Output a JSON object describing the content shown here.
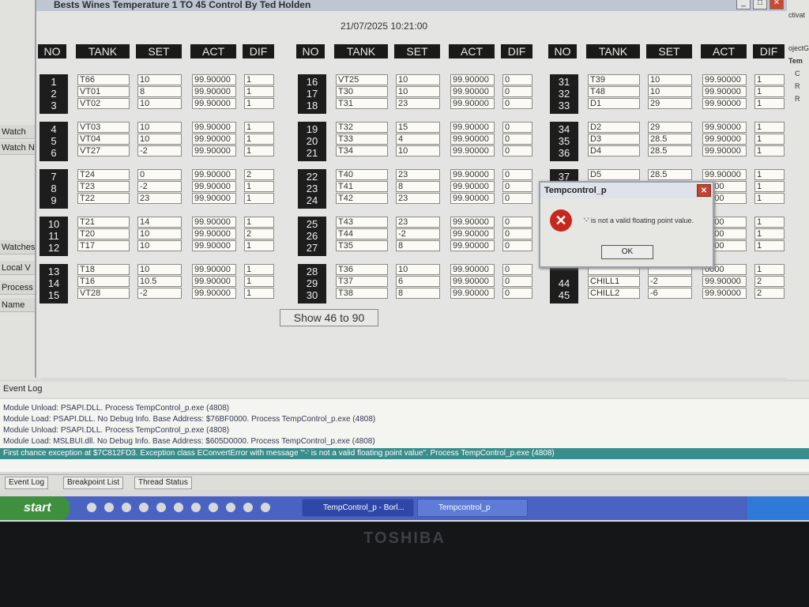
{
  "window": {
    "title": "Bests Wines Temperature 1  TO 45 Control By Ted Holden",
    "datetime": "21/07/2025 10:21:00"
  },
  "headers": [
    "NO",
    "TANK",
    "SET",
    "ACT",
    "DIF"
  ],
  "columns": [
    {
      "groups": [
        [
          {
            "no": "1",
            "tank": "T66",
            "set": "10",
            "act": "99.90000",
            "dif": "1"
          },
          {
            "no": "2",
            "tank": "VT01",
            "set": "8",
            "act": "99.90000",
            "dif": "1"
          },
          {
            "no": "3",
            "tank": "VT02",
            "set": "10",
            "act": "99.90000",
            "dif": "1"
          }
        ],
        [
          {
            "no": "4",
            "tank": "VT03",
            "set": "10",
            "act": "99.90000",
            "dif": "1"
          },
          {
            "no": "5",
            "tank": "VT04",
            "set": "10",
            "act": "99.90000",
            "dif": "1"
          },
          {
            "no": "6",
            "tank": "VT27",
            "set": "-2",
            "act": "99.90000",
            "dif": "1"
          }
        ],
        [
          {
            "no": "7",
            "tank": "T24",
            "set": "0",
            "act": "99.90000",
            "dif": "2"
          },
          {
            "no": "8",
            "tank": "T23",
            "set": "-2",
            "act": "99.90000",
            "dif": "1"
          },
          {
            "no": "9",
            "tank": "T22",
            "set": "23",
            "act": "99.90000",
            "dif": "1"
          }
        ],
        [
          {
            "no": "10",
            "tank": "T21",
            "set": "14",
            "act": "99.90000",
            "dif": "1"
          },
          {
            "no": "11",
            "tank": "T20",
            "set": "10",
            "act": "99.90000",
            "dif": "2"
          },
          {
            "no": "12",
            "tank": "T17",
            "set": "10",
            "act": "99.90000",
            "dif": "1"
          }
        ],
        [
          {
            "no": "13",
            "tank": "T18",
            "set": "10",
            "act": "99.90000",
            "dif": "1"
          },
          {
            "no": "14",
            "tank": "T16",
            "set": "10.5",
            "act": "99.90000",
            "dif": "1"
          },
          {
            "no": "15",
            "tank": "VT28",
            "set": "-2",
            "act": "99.90000",
            "dif": "1"
          }
        ]
      ]
    },
    {
      "groups": [
        [
          {
            "no": "16",
            "tank": "VT25",
            "set": "10",
            "act": "99.90000",
            "dif": "0"
          },
          {
            "no": "17",
            "tank": "T30",
            "set": "10",
            "act": "99.90000",
            "dif": "0"
          },
          {
            "no": "18",
            "tank": "T31",
            "set": "23",
            "act": "99.90000",
            "dif": "0"
          }
        ],
        [
          {
            "no": "19",
            "tank": "T32",
            "set": "15",
            "act": "99.90000",
            "dif": "0"
          },
          {
            "no": "20",
            "tank": "T33",
            "set": "4",
            "act": "99.90000",
            "dif": "0"
          },
          {
            "no": "21",
            "tank": "T34",
            "set": "10",
            "act": "99.90000",
            "dif": "0"
          }
        ],
        [
          {
            "no": "22",
            "tank": "T40",
            "set": "23",
            "act": "99.90000",
            "dif": "0"
          },
          {
            "no": "23",
            "tank": "T41",
            "set": "8",
            "act": "99.90000",
            "dif": "0"
          },
          {
            "no": "24",
            "tank": "T42",
            "set": "23",
            "act": "99.90000",
            "dif": "0"
          }
        ],
        [
          {
            "no": "25",
            "tank": "T43",
            "set": "23",
            "act": "99.90000",
            "dif": "0"
          },
          {
            "no": "26",
            "tank": "T44",
            "set": "-2",
            "act": "99.90000",
            "dif": "0"
          },
          {
            "no": "27",
            "tank": "T35",
            "set": "8",
            "act": "99.90000",
            "dif": "0"
          }
        ],
        [
          {
            "no": "28",
            "tank": "T36",
            "set": "10",
            "act": "99.90000",
            "dif": "0"
          },
          {
            "no": "29",
            "tank": "T37",
            "set": "6",
            "act": "99.90000",
            "dif": "0"
          },
          {
            "no": "30",
            "tank": "T38",
            "set": "8",
            "act": "99.90000",
            "dif": "0"
          }
        ]
      ]
    },
    {
      "groups": [
        [
          {
            "no": "31",
            "tank": "T39",
            "set": "10",
            "act": "99.90000",
            "dif": "1"
          },
          {
            "no": "32",
            "tank": "T48",
            "set": "10",
            "act": "99.90000",
            "dif": "1"
          },
          {
            "no": "33",
            "tank": "D1",
            "set": "29",
            "act": "99.90000",
            "dif": "1"
          }
        ],
        [
          {
            "no": "34",
            "tank": "D2",
            "set": "29",
            "act": "99.90000",
            "dif": "1"
          },
          {
            "no": "35",
            "tank": "D3",
            "set": "28.5",
            "act": "99.90000",
            "dif": "1"
          },
          {
            "no": "36",
            "tank": "D4",
            "set": "28.5",
            "act": "99.90000",
            "dif": "1"
          }
        ],
        [
          {
            "no": "37",
            "tank": "D5",
            "set": "28.5",
            "act": "99.90000",
            "dif": "1"
          },
          {
            "no": "",
            "tank": "",
            "set": "",
            "act": "0000",
            "dif": "1"
          },
          {
            "no": "",
            "tank": "",
            "set": "",
            "act": "0000",
            "dif": "1"
          }
        ],
        [
          {
            "no": "",
            "tank": "",
            "set": "",
            "act": "0000",
            "dif": "1"
          },
          {
            "no": "",
            "tank": "",
            "set": "",
            "act": "0000",
            "dif": "1"
          },
          {
            "no": "",
            "tank": "",
            "set": "",
            "act": "0000",
            "dif": "1"
          }
        ],
        [
          {
            "no": "",
            "tank": "",
            "set": "",
            "act": "0000",
            "dif": "1"
          },
          {
            "no": "44",
            "tank": "CHILL1",
            "set": "-2",
            "act": "99.90000",
            "dif": "2"
          },
          {
            "no": "45",
            "tank": "CHILL2",
            "set": "-6",
            "act": "99.90000",
            "dif": "2"
          }
        ]
      ]
    }
  ],
  "show_button": "Show  46 to 90",
  "dialog": {
    "title": "Tempcontrol_p",
    "message": "'-' is not a valid floating point value.",
    "ok": "OK",
    "icon": "error-icon"
  },
  "ide_left": [
    "Watch",
    "Watch Nam",
    "Watches",
    "Local V",
    "Process is r",
    "Name"
  ],
  "ide_right": [
    "ojectGr",
    "Tem",
    "C",
    "R",
    "R",
    "ctivat"
  ],
  "event_log": {
    "title": "Event Log",
    "lines": [
      "Module Unload: PSAPI.DLL. Process TempControl_p.exe (4808)",
      "Module Load: PSAPI.DLL. No Debug Info. Base Address: $76BF0000. Process TempControl_p.exe (4808)",
      "Module Unload: PSAPI.DLL. Process TempControl_p.exe (4808)",
      "Module Load: MSLBUI.dll. No Debug Info. Base Address: $605D0000. Process TempControl_p.exe (4808)",
      "First chance exception at $7C812FD3. Exception class EConvertError with message \"'-' is not a valid floating point value\". Process TempControl_p.exe (4808)"
    ]
  },
  "bottom_tabs": [
    "Event Log",
    "Breakpoint List",
    "Thread Status"
  ],
  "taskbar": {
    "start": "start",
    "items": [
      "TempControl_p - Borl...",
      "Tempcontrol_p"
    ]
  },
  "brand": "TOSHIBA"
}
